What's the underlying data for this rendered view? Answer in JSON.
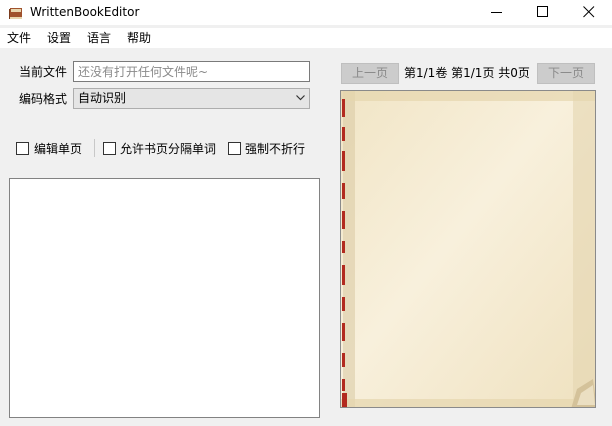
{
  "window": {
    "title": "WrittenBookEditor"
  },
  "menu": [
    "文件",
    "设置",
    "语言",
    "帮助"
  ],
  "file": {
    "label": "当前文件",
    "placeholder": "还没有打开任何文件呢~"
  },
  "encoding": {
    "label": "编码格式",
    "value": "自动识别"
  },
  "options": {
    "edit_single_page": "编辑单页",
    "allow_split_words": "允许书页分隔单词",
    "force_no_wrap": "强制不折行"
  },
  "editor": {
    "content": ""
  },
  "pager": {
    "prev_label": "上一页",
    "next_label": "下一页",
    "info": "第1/1卷 第1/1页 共0页"
  },
  "icons": {
    "app": "book-icon",
    "minimize": "minimize-icon",
    "maximize": "maximize-icon",
    "close": "close-icon",
    "dropdown": "chevron-down-icon"
  },
  "colors": {
    "page_background": "#f4ebd6",
    "book_spine_red": "#b22a1f",
    "button_disabled_bg": "#cccccc",
    "window_bg": "#f0f0f0"
  }
}
